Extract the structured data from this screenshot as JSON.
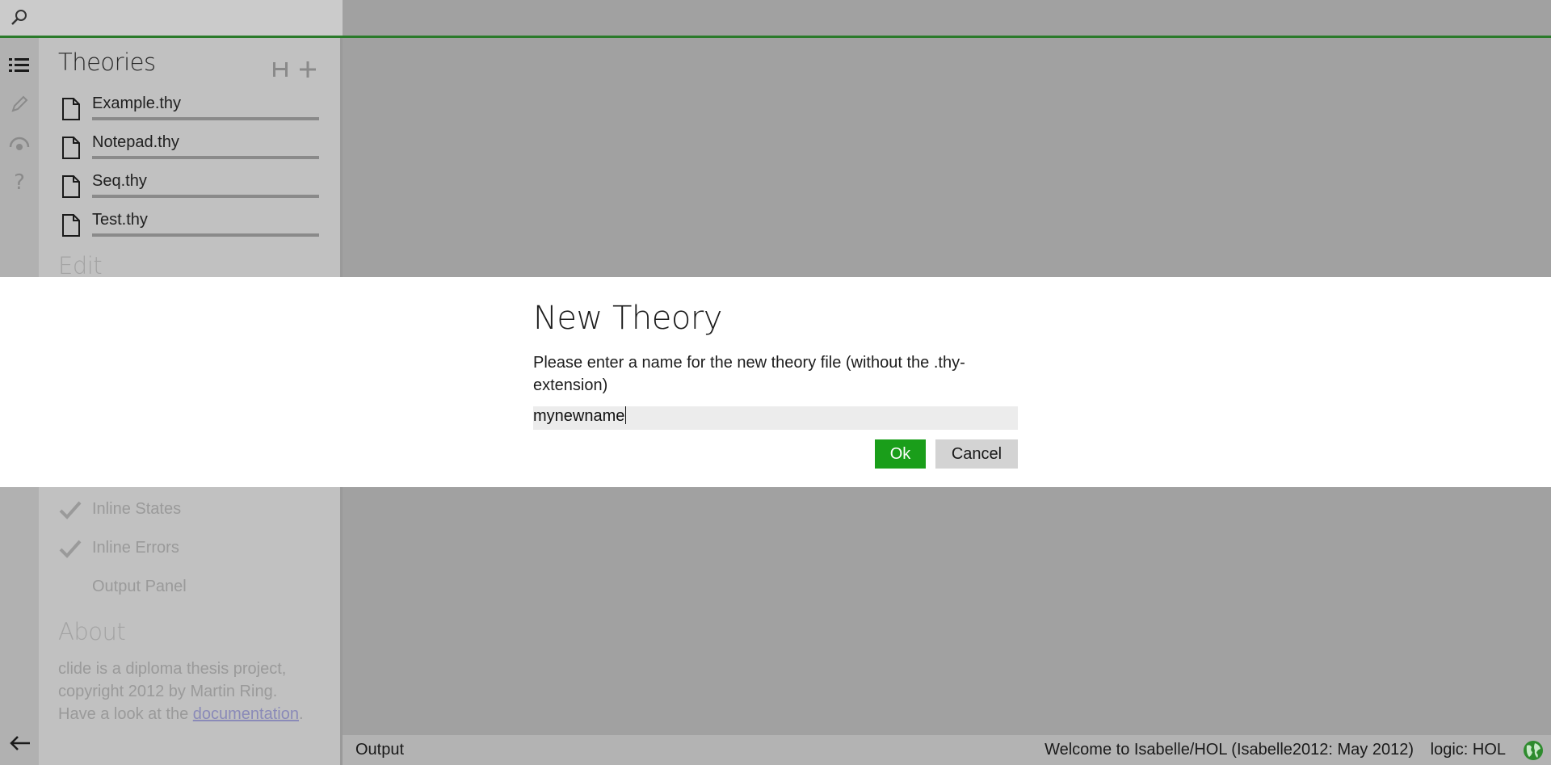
{
  "search": {
    "icon": "search-icon"
  },
  "iconbar": {
    "items": [
      {
        "icon": "list-icon",
        "active": true
      },
      {
        "icon": "pencil-icon",
        "active": false
      },
      {
        "icon": "eye-icon",
        "active": false
      },
      {
        "icon": "question-icon",
        "active": false
      }
    ],
    "back_icon": "arrow-left-icon"
  },
  "sidebar": {
    "theories_title": "Theories",
    "tools": [
      "save-icon",
      "plus-icon"
    ],
    "files": [
      {
        "name": "Example.thy"
      },
      {
        "name": "Notepad.thy"
      },
      {
        "name": "Seq.thy"
      },
      {
        "name": "Test.thy"
      }
    ],
    "edit_title": "Edit",
    "options": [
      {
        "label": "Inline States",
        "checked": true
      },
      {
        "label": "Inline Errors",
        "checked": true
      },
      {
        "label": "Output Panel",
        "checked": false
      }
    ],
    "about_title": "About",
    "about_text_1": "clide is a diploma thesis project, copyright 2012 by Martin Ring. Have a look at the ",
    "about_link": "documentation",
    "about_text_2": "."
  },
  "statusbar": {
    "output_label": "Output",
    "welcome": "Welcome to Isabelle/HOL (Isabelle2012: May 2012)",
    "logic": "logic: HOL",
    "globe_icon": "globe-icon"
  },
  "modal": {
    "title": "New Theory",
    "message": "Please enter a name for the new theory file (without the .thy-extension)",
    "input_value": "mynewname",
    "ok_label": "Ok",
    "cancel_label": "Cancel"
  },
  "colors": {
    "accent_green": "#1a9e1a",
    "top_line": "#2a7a2a"
  }
}
